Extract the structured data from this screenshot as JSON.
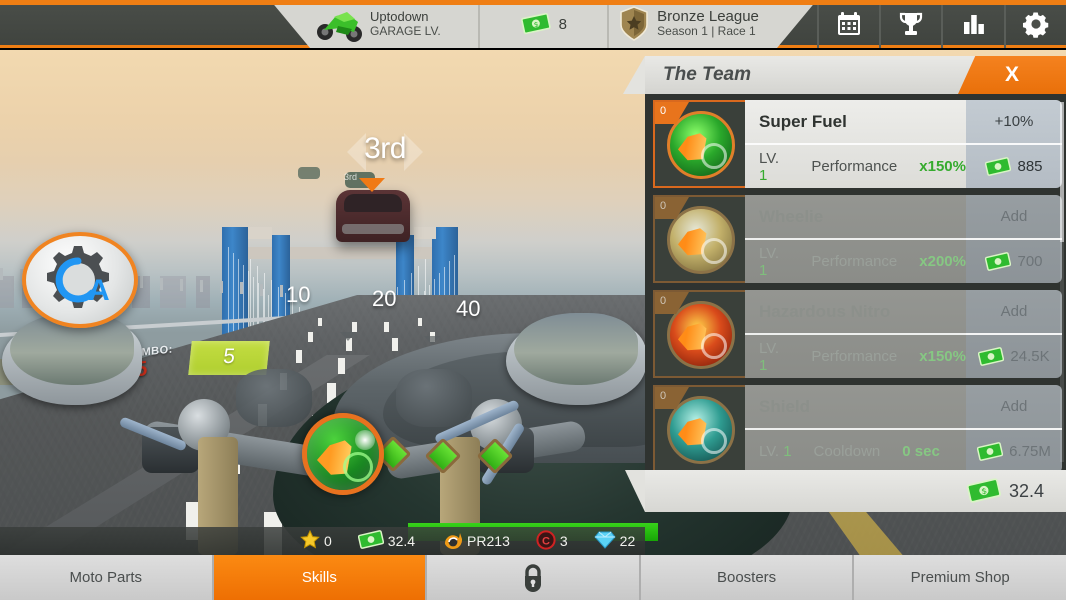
{
  "topbar": {
    "profile": {
      "name": "Uptodown",
      "sub": "GARAGE LV.",
      "icon": "motorcycle-icon"
    },
    "money": {
      "value": "8",
      "icon": "cash-icon"
    },
    "league": {
      "name": "Bronze League",
      "sub": "Season 1 | Race 1",
      "icon": "shield-badge-icon"
    },
    "buttons": [
      {
        "name": "calendar-icon",
        "label": ""
      },
      {
        "name": "trophy-icon",
        "label": ""
      },
      {
        "name": "leaderboard-icon",
        "label": ""
      },
      {
        "name": "settings-gear-icon",
        "label": ""
      }
    ]
  },
  "hud": {
    "position": "3rd",
    "position_small": "3rd",
    "gear_mode": "A",
    "combo_label": "COMBO:",
    "combo_multiplier": "x5",
    "combo_value": "5",
    "ticks": [
      "10",
      "20",
      "40"
    ]
  },
  "panel": {
    "title": "The Team",
    "close_label": "X",
    "footer_money": "32.4",
    "items": [
      {
        "badge": "0",
        "name": "Super Fuel",
        "level_label": "LV.",
        "level": "1",
        "stat_type": "Performance",
        "stat_value": "x150%",
        "action": "+10%",
        "price": "885",
        "locked": false,
        "thumb": "t1"
      },
      {
        "badge": "0",
        "name": "Wheelie",
        "level_label": "LV.",
        "level": "1",
        "stat_type": "Performance",
        "stat_value": "x200%",
        "action": "Add",
        "price": "700",
        "locked": true,
        "thumb": "t2"
      },
      {
        "badge": "0",
        "name": "Hazardous Nitro",
        "level_label": "LV.",
        "level": "1",
        "stat_type": "Performance",
        "stat_value": "x150%",
        "action": "Add",
        "price": "24.5K",
        "locked": true,
        "thumb": "t3"
      },
      {
        "badge": "0",
        "name": "Shield",
        "level_label": "LV.",
        "level": "1",
        "stat_type": "Cooldown",
        "stat_value": "0 sec",
        "action": "Add",
        "price": "6.75M",
        "locked": true,
        "thumb": "t4"
      }
    ]
  },
  "stats": [
    {
      "icon": "star-icon",
      "value": "0"
    },
    {
      "icon": "cash-icon",
      "value": "32.4"
    },
    {
      "icon": "fire-helmet-icon",
      "value": "PR213"
    },
    {
      "icon": "coin-c-icon",
      "value": "3"
    },
    {
      "icon": "diamond-icon",
      "value": "22"
    }
  ],
  "nav": {
    "tabs": [
      {
        "label": "Moto Parts",
        "active": false,
        "locked": false
      },
      {
        "label": "Skills",
        "active": true,
        "locked": false
      },
      {
        "label": "",
        "active": false,
        "locked": true,
        "icon": "lock-icon"
      },
      {
        "label": "Boosters",
        "active": false,
        "locked": false
      },
      {
        "label": "Premium Shop",
        "active": false,
        "locked": false
      }
    ]
  },
  "colors": {
    "accent_orange": "#ef7e14",
    "panel_grey": "#d6d6d1",
    "bar_dark": "#4a4e49",
    "green_text": "#35ab2e",
    "combo_red": "#cf2f1b"
  }
}
